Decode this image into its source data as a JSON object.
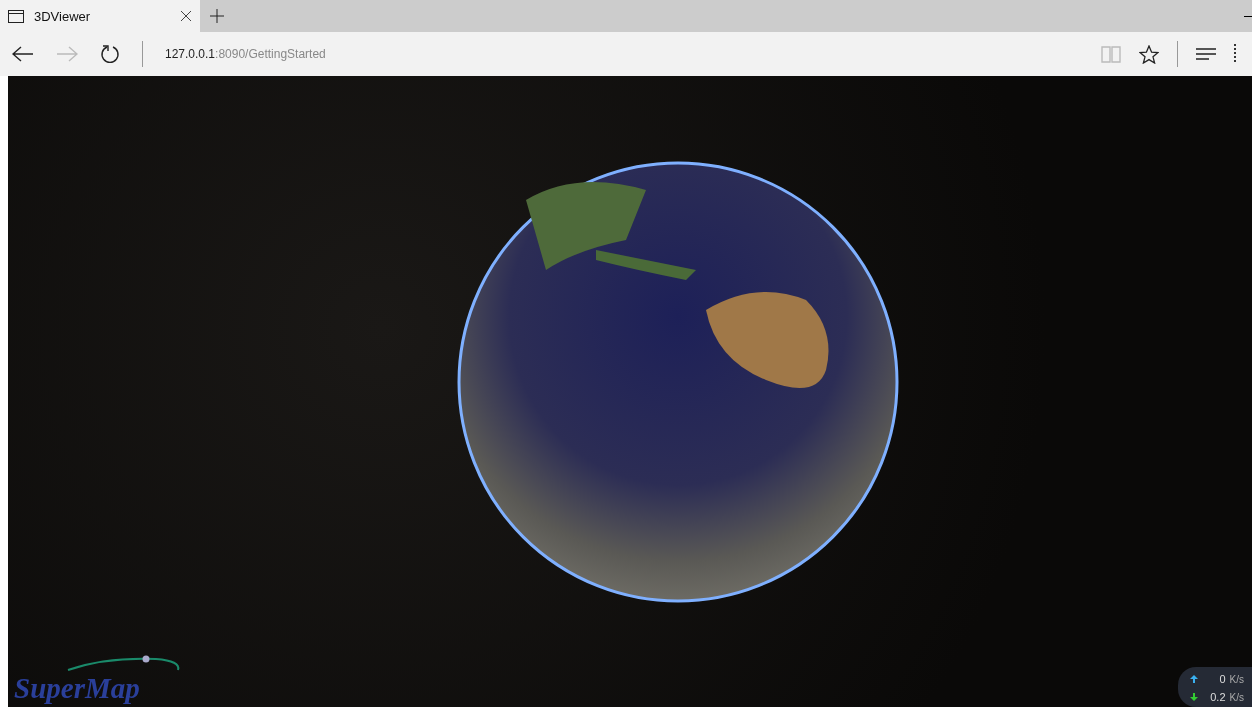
{
  "tab": {
    "title": "3DViewer",
    "selected": true
  },
  "address": {
    "host": "127.0.0.1",
    "path": ":8090/GettingStarted"
  },
  "viewer": {
    "logo": "SuperMap",
    "speeds": [
      {
        "kind": "up",
        "value": "0",
        "unit": "K/s"
      },
      {
        "kind": "down",
        "value": "0.2",
        "unit": "K/s"
      }
    ]
  }
}
